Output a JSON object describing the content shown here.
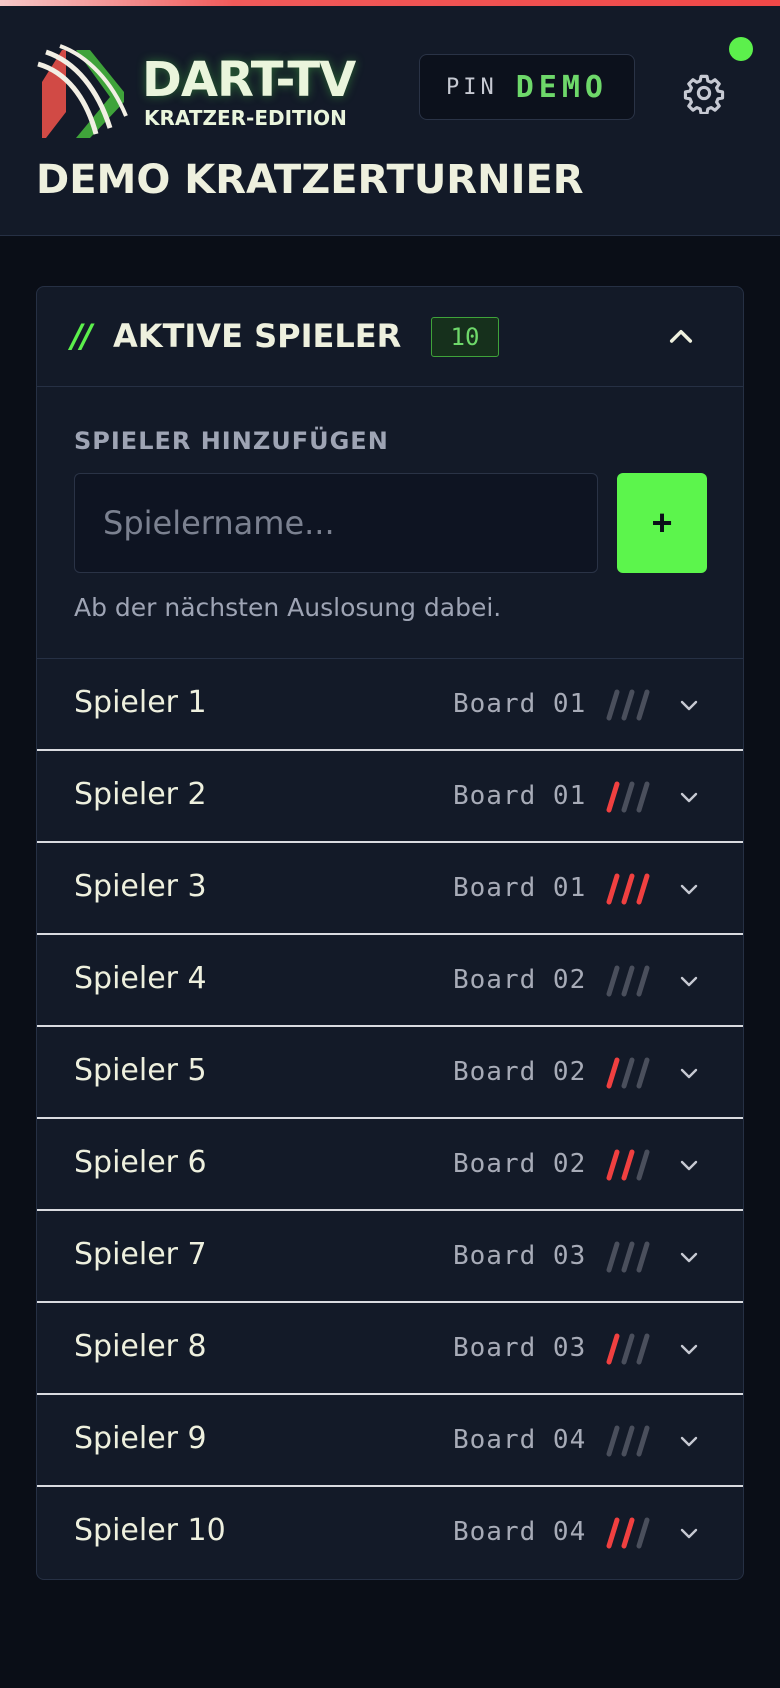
{
  "header": {
    "brand_title": "DART-TV",
    "brand_subtitle": "KRATZER-EDITION",
    "pin_label": "PIN",
    "pin_value": "DEMO",
    "tournament_title": "DEMO KRATZERTURNIER",
    "status_color": "#5cf04c"
  },
  "players_card": {
    "slashes": "//",
    "title": "AKTIVE SPIELER",
    "count": "10",
    "add_label": "SPIELER HINZUFÜGEN",
    "input_placeholder": "Spielername...",
    "input_value": "",
    "add_button": "+",
    "add_hint": "Ab der nächsten Auslosung dabei."
  },
  "colors": {
    "accent_green": "#5cf54c",
    "scratch_active": "#f04040",
    "scratch_inactive": "#4a4f5c"
  },
  "players": [
    {
      "name": "Spieler 1",
      "board": "Board 01",
      "scratches": 0
    },
    {
      "name": "Spieler 2",
      "board": "Board 01",
      "scratches": 1
    },
    {
      "name": "Spieler 3",
      "board": "Board 01",
      "scratches": 3
    },
    {
      "name": "Spieler 4",
      "board": "Board 02",
      "scratches": 0
    },
    {
      "name": "Spieler 5",
      "board": "Board 02",
      "scratches": 1
    },
    {
      "name": "Spieler 6",
      "board": "Board 02",
      "scratches": 2
    },
    {
      "name": "Spieler 7",
      "board": "Board 03",
      "scratches": 0
    },
    {
      "name": "Spieler 8",
      "board": "Board 03",
      "scratches": 1
    },
    {
      "name": "Spieler 9",
      "board": "Board 04",
      "scratches": 0
    },
    {
      "name": "Spieler 10",
      "board": "Board 04",
      "scratches": 2
    }
  ]
}
